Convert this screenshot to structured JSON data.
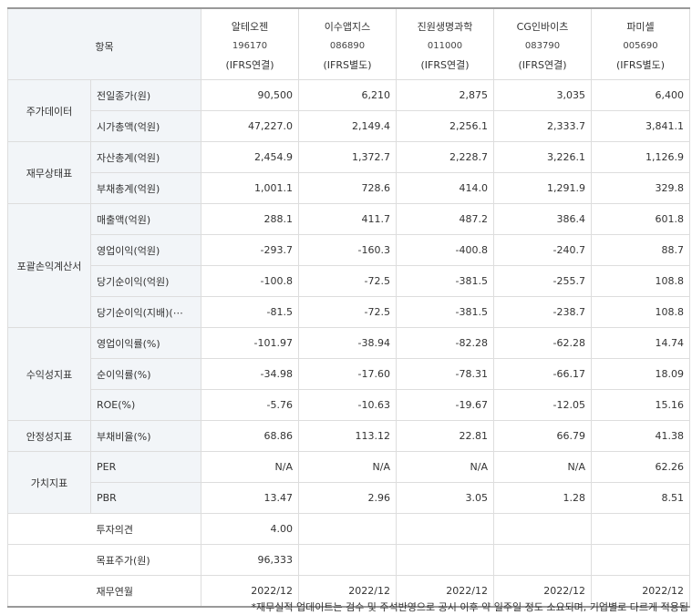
{
  "header": {
    "category_label": "항목",
    "companies": [
      {
        "name": "알테오젠",
        "code": "196170",
        "basis": "(IFRS연결)"
      },
      {
        "name": "이수앱지스",
        "code": "086890",
        "basis": "(IFRS별도)"
      },
      {
        "name": "진원생명과학",
        "code": "011000",
        "basis": "(IFRS연결)"
      },
      {
        "name": "CG인바이츠",
        "code": "083790",
        "basis": "(IFRS연결)"
      },
      {
        "name": "파미셀",
        "code": "005690",
        "basis": "(IFRS별도)"
      }
    ]
  },
  "groups": [
    {
      "name": "주가데이터",
      "rows": [
        {
          "item": "전일종가(원)",
          "values": [
            "90,500",
            "6,210",
            "2,875",
            "3,035",
            "6,400"
          ]
        },
        {
          "item": "시가총액(억원)",
          "values": [
            "47,227.0",
            "2,149.4",
            "2,256.1",
            "2,333.7",
            "3,841.1"
          ]
        }
      ]
    },
    {
      "name": "재무상태표",
      "rows": [
        {
          "item": "자산총계(억원)",
          "values": [
            "2,454.9",
            "1,372.7",
            "2,228.7",
            "3,226.1",
            "1,126.9"
          ]
        },
        {
          "item": "부채총계(억원)",
          "values": [
            "1,001.1",
            "728.6",
            "414.0",
            "1,291.9",
            "329.8"
          ]
        }
      ]
    },
    {
      "name": "포괄손익계산서",
      "rows": [
        {
          "item": "매출액(억원)",
          "values": [
            "288.1",
            "411.7",
            "487.2",
            "386.4",
            "601.8"
          ]
        },
        {
          "item": "영업이익(억원)",
          "values": [
            "-293.7",
            "-160.3",
            "-400.8",
            "-240.7",
            "88.7"
          ]
        },
        {
          "item": "당기순이익(억원)",
          "values": [
            "-100.8",
            "-72.5",
            "-381.5",
            "-255.7",
            "108.8"
          ]
        },
        {
          "item": "당기순이익(지배)(⋯",
          "values": [
            "-81.5",
            "-72.5",
            "-381.5",
            "-238.7",
            "108.8"
          ]
        }
      ]
    },
    {
      "name": "수익성지표",
      "rows": [
        {
          "item": "영업이익률(%)",
          "values": [
            "-101.97",
            "-38.94",
            "-82.28",
            "-62.28",
            "14.74"
          ]
        },
        {
          "item": "순이익률(%)",
          "values": [
            "-34.98",
            "-17.60",
            "-78.31",
            "-66.17",
            "18.09"
          ]
        },
        {
          "item": "ROE(%)",
          "values": [
            "-5.76",
            "-10.63",
            "-19.67",
            "-12.05",
            "15.16"
          ]
        }
      ]
    },
    {
      "name": "안정성지표",
      "rows": [
        {
          "item": "부채비율(%)",
          "values": [
            "68.86",
            "113.12",
            "22.81",
            "66.79",
            "41.38"
          ]
        }
      ]
    },
    {
      "name": "가치지표",
      "rows": [
        {
          "item": "PER",
          "values": [
            "N/A",
            "N/A",
            "N/A",
            "N/A",
            "62.26"
          ]
        },
        {
          "item": "PBR",
          "values": [
            "13.47",
            "2.96",
            "3.05",
            "1.28",
            "8.51"
          ]
        }
      ]
    }
  ],
  "extra_rows": [
    {
      "item": "투자의견",
      "values": [
        "4.00",
        "",
        "",
        "",
        ""
      ]
    },
    {
      "item": "목표주가(원)",
      "values": [
        "96,333",
        "",
        "",
        "",
        ""
      ]
    },
    {
      "item": "재무연월",
      "values": [
        "2022/12",
        "2022/12",
        "2022/12",
        "2022/12",
        "2022/12"
      ]
    }
  ],
  "footnote": "*재무실적 업데이트는 검수 및 주석반영으로 공시 이후 약 일주일 정도 소요되며, 기업별로 다르게 적용됨"
}
